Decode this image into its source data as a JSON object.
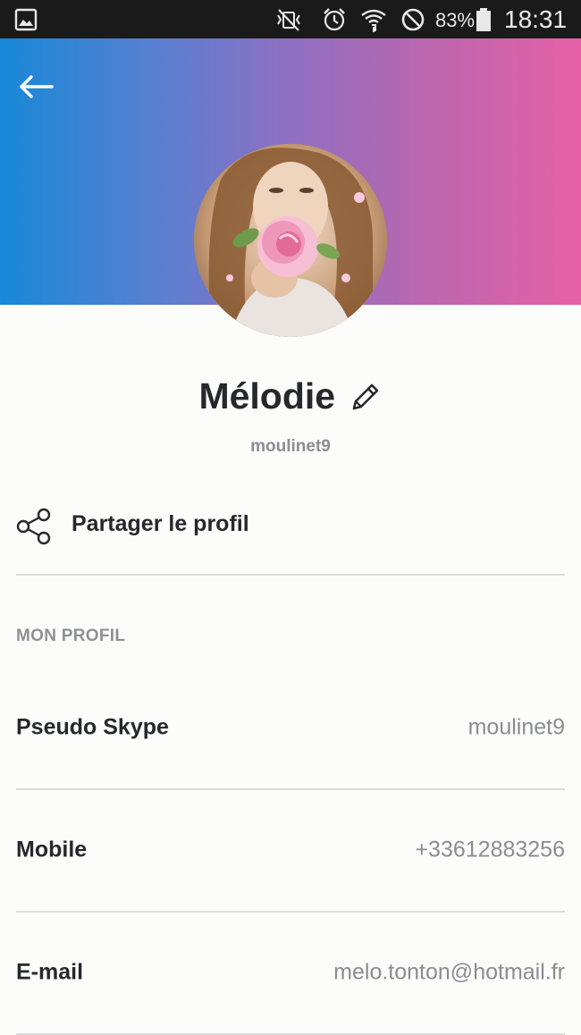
{
  "status_bar": {
    "battery_percent": "83%",
    "time": "18:31",
    "icons": [
      "image-notification-icon",
      "vibrate-mute-icon",
      "alarm-icon",
      "wifi-icon",
      "do-not-disturb-icon",
      "battery-icon"
    ]
  },
  "header": {
    "back_icon": "arrow-left-icon",
    "gradient_colors": [
      "#1888d8",
      "#8f6fc2",
      "#e660a6"
    ]
  },
  "profile": {
    "name": "Mélodie",
    "edit_icon": "pencil-icon",
    "username": "moulinet9"
  },
  "share": {
    "label": "Partager le profil",
    "icon": "share-icon"
  },
  "section": {
    "title": "MON PROFIL"
  },
  "rows": [
    {
      "label": "Pseudo Skype",
      "value": "moulinet9"
    },
    {
      "label": "Mobile",
      "value": "+33612883256"
    },
    {
      "label": "E-mail",
      "value": "melo.tonton@hotmail.fr"
    }
  ]
}
